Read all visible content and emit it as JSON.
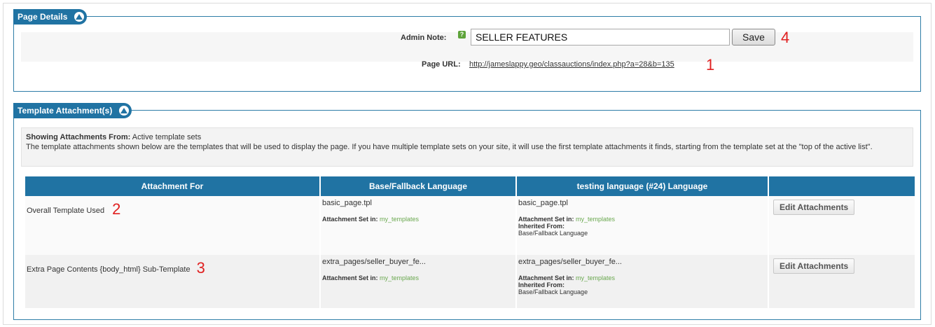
{
  "page_details": {
    "title": "Page Details",
    "admin_note_label": "Admin Note:",
    "admin_note_help": "?",
    "admin_note_value": "SELLER FEATURES",
    "save_label": "Save",
    "page_url_label": "Page URL:",
    "page_url": "http://jameslappy.geo/classauctions/index.php?a=28&b=135"
  },
  "template_attachments": {
    "title": "Template Attachment(s)",
    "showing_label": "Showing Attachments From:",
    "showing_value": "Active template sets",
    "description": "The template attachments shown below are the templates that will be used to display the page. If you have multiple template sets on your site, it will use the first template attachments it finds, starting from the template set at the \"top of the active list\".",
    "columns": [
      "Attachment For",
      "Base/Fallback Language",
      "testing language (#24) Language",
      ""
    ],
    "rows": [
      {
        "attachment_for": "Overall Template Used",
        "base_file": "basic_page.tpl",
        "base_set_label": "Attachment Set in:",
        "base_set_value": "my_templates",
        "lang_file": "basic_page.tpl",
        "lang_set_label": "Attachment Set in:",
        "lang_set_value": "my_templates",
        "inherited_label": "Inherited From:",
        "inherited_value": "Base/Fallback Language",
        "edit_label": "Edit Attachments"
      },
      {
        "attachment_for": "Extra Page Contents {body_html} Sub-Template",
        "base_file": "extra_pages/seller_buyer_fe...",
        "base_set_label": "Attachment Set in:",
        "base_set_value": "my_templates",
        "lang_file": "extra_pages/seller_buyer_fe...",
        "lang_set_label": "Attachment Set in:",
        "lang_set_value": "my_templates",
        "inherited_label": "Inherited From:",
        "inherited_value": "Base/Fallback Language",
        "edit_label": "Edit Attachments"
      }
    ]
  },
  "annotations": {
    "a1": "1",
    "a2": "2",
    "a3": "3",
    "a4": "4"
  },
  "colors": {
    "header_blue": "#2073a3",
    "link_green": "#6aa84f",
    "annotation_red": "#e02020"
  },
  "icons": {
    "collapse": "chevron-up-icon",
    "help": "help-icon"
  }
}
